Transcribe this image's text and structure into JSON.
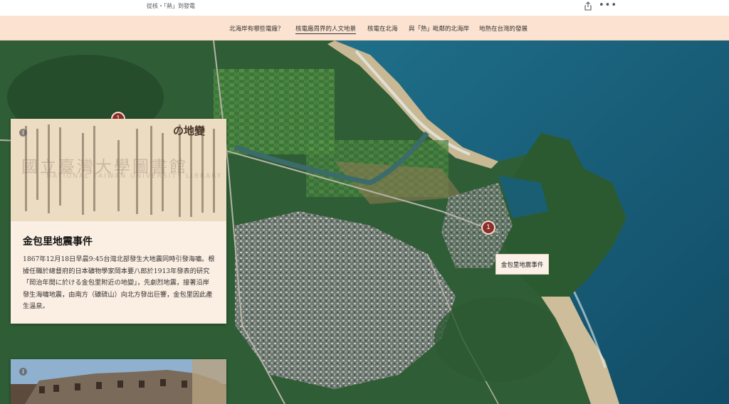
{
  "story": {
    "title": "從核・「熱」到發電"
  },
  "nav": {
    "items": [
      {
        "label": "北海岸有哪些電廠？",
        "active": false
      },
      {
        "label": "核電廠周界的人文地景",
        "active": true
      },
      {
        "label": "核電在北海",
        "active": false
      },
      {
        "label": "與「熱」毗鄰的北海岸",
        "active": false
      },
      {
        "label": "地熱在台灣的發展",
        "active": false
      }
    ]
  },
  "map": {
    "markers": [
      {
        "number": "1",
        "label": "金包里地震事件"
      },
      {
        "number": "1"
      }
    ]
  },
  "card": {
    "title": "金包里地震事件",
    "body": "1867年12月18日早晨9:45台灣北部發生大地震同時引發海嘯。根據任職於總督府的日本礦物學家岡本要八郎於1913年發表的研究「岡治年間に於ける金包里附近の地變」，先劇烈地震，接著沿岸發生海嘯地震，由南方（礦硫山）向北方發出巨響，金包里因此產生溫泉。",
    "image": {
      "headline": "の地變",
      "watermark": "國立臺灣大學圖書館",
      "watermark_en": "NATIONAL TAIWAN UNIVERSITY LIBRARY"
    }
  },
  "colors": {
    "marker": "#8c2f2a",
    "nav_bg": "#fce3d1",
    "card_bg": "#fbeee2"
  }
}
